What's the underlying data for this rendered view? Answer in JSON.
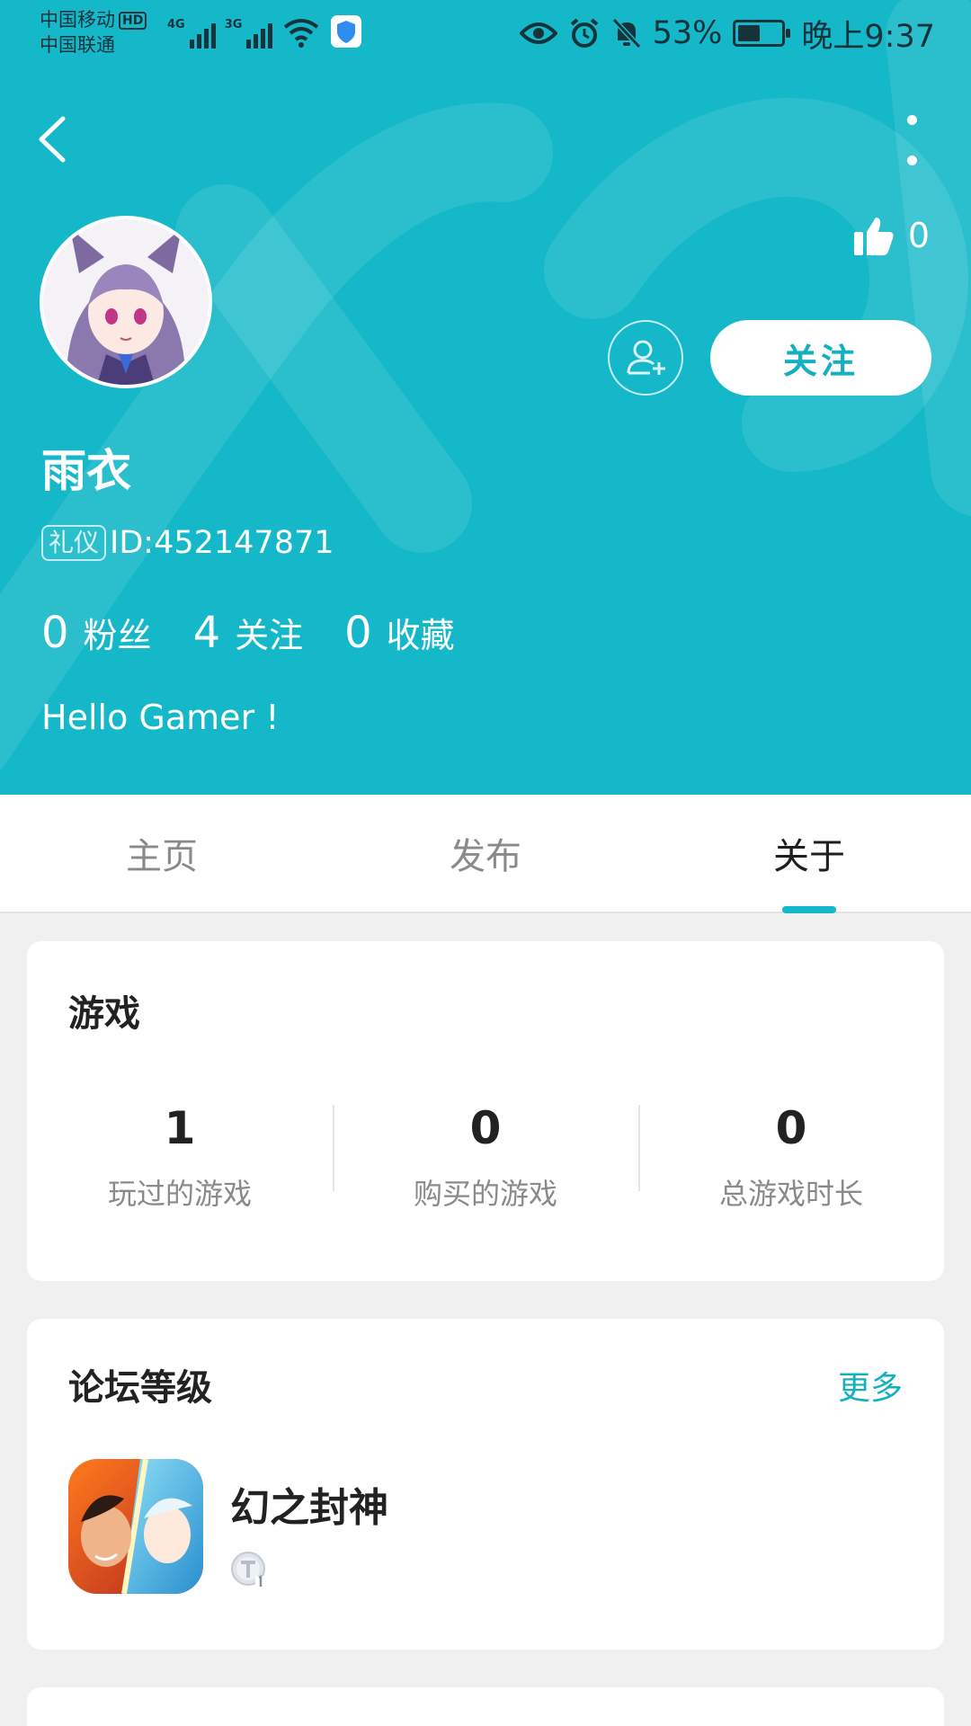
{
  "status_bar": {
    "carrier_1": "中国移动",
    "carrier_2": "中国联通",
    "hd": "HD",
    "net_1": "4G",
    "net_2": "3G",
    "battery_percent": "53%",
    "battery_level": 0.53,
    "time": "晚上9:37"
  },
  "profile": {
    "likes": "0",
    "follow_label": "关注",
    "username": "雨衣",
    "badge": "礼仪",
    "user_id": "ID:452147871",
    "stats": [
      {
        "value": "0",
        "label": "粉丝"
      },
      {
        "value": "4",
        "label": "关注"
      },
      {
        "value": "0",
        "label": "收藏"
      }
    ],
    "bio": "Hello Gamer !"
  },
  "tabs": [
    {
      "label": "主页"
    },
    {
      "label": "发布"
    },
    {
      "label": "关于"
    }
  ],
  "games_card": {
    "title": "游戏",
    "stats": [
      {
        "value": "1",
        "label": "玩过的游戏"
      },
      {
        "value": "0",
        "label": "购买的游戏"
      },
      {
        "value": "0",
        "label": "总游戏时长"
      }
    ]
  },
  "forum_card": {
    "title": "论坛等级",
    "more_label": "更多",
    "game_name": "幻之封神"
  },
  "colors": {
    "accent": "#14b8c8",
    "background": "#f0f0f0"
  }
}
